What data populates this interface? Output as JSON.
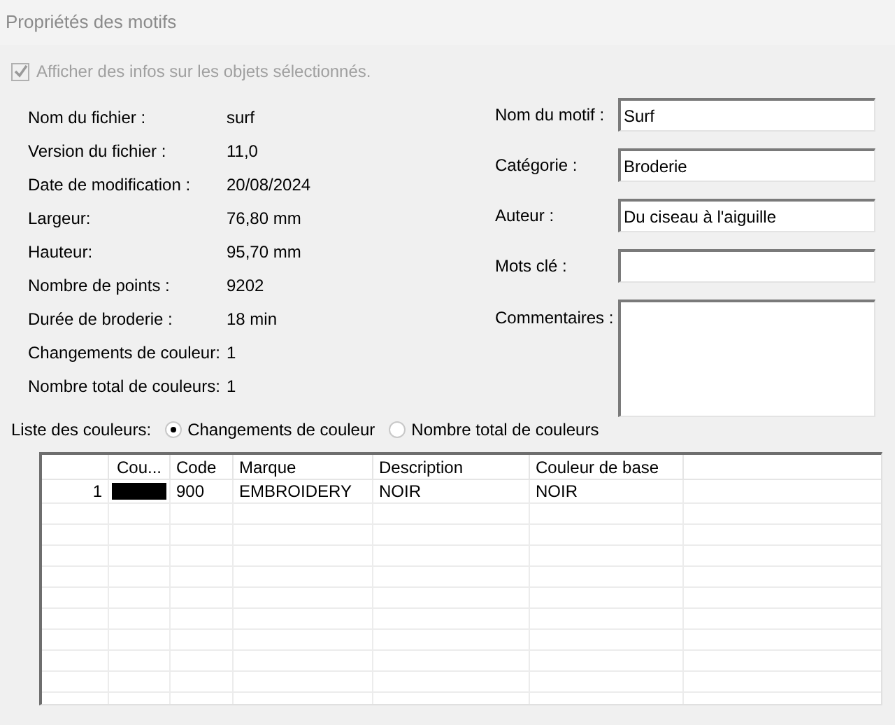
{
  "window": {
    "title": "Propriétés des motifs"
  },
  "show_info_checkbox": {
    "label": "Afficher des infos sur les objets sélectionnés.",
    "checked": true,
    "disabled": true
  },
  "file_info": [
    {
      "label": "Nom du fichier :",
      "value": "surf"
    },
    {
      "label": "Version du fichier :",
      "value": "11,0"
    },
    {
      "label": "Date de modification :",
      "value": "20/08/2024"
    },
    {
      "label": "Largeur:",
      "value": "76,80 mm"
    },
    {
      "label": "Hauteur:",
      "value": "95,70 mm"
    },
    {
      "label": "Nombre de points :",
      "value": "9202"
    },
    {
      "label": "Durée de broderie :",
      "value": "18 min"
    },
    {
      "label": "Changements de couleur:",
      "value": "1"
    },
    {
      "label": "Nombre total de couleurs:",
      "value": "1"
    }
  ],
  "fields": [
    {
      "label": "Nom du motif :",
      "value": "Surf",
      "kind": "line"
    },
    {
      "label": "Catégorie :",
      "value": "Broderie",
      "kind": "line"
    },
    {
      "label": "Auteur :",
      "value": "Du ciseau à l'aiguille",
      "kind": "line"
    },
    {
      "label": "Mots clé :",
      "kind": "line"
    },
    {
      "label": "Commentaires :",
      "kind": "area"
    }
  ],
  "color_list": {
    "label": "Liste des couleurs:",
    "options": [
      {
        "label": "Changements de couleur",
        "selected": true
      },
      {
        "label": "Nombre total de couleurs",
        "selected": false
      }
    ]
  },
  "table": {
    "columns": [
      "",
      "Cou...",
      "Code",
      "Marque",
      "Description",
      "Couleur de base"
    ],
    "rows": [
      {
        "index": "1",
        "color": "#000000",
        "code": "900",
        "brand": "EMBROIDERY",
        "description": "NOIR",
        "base_color": "NOIR"
      }
    ]
  }
}
